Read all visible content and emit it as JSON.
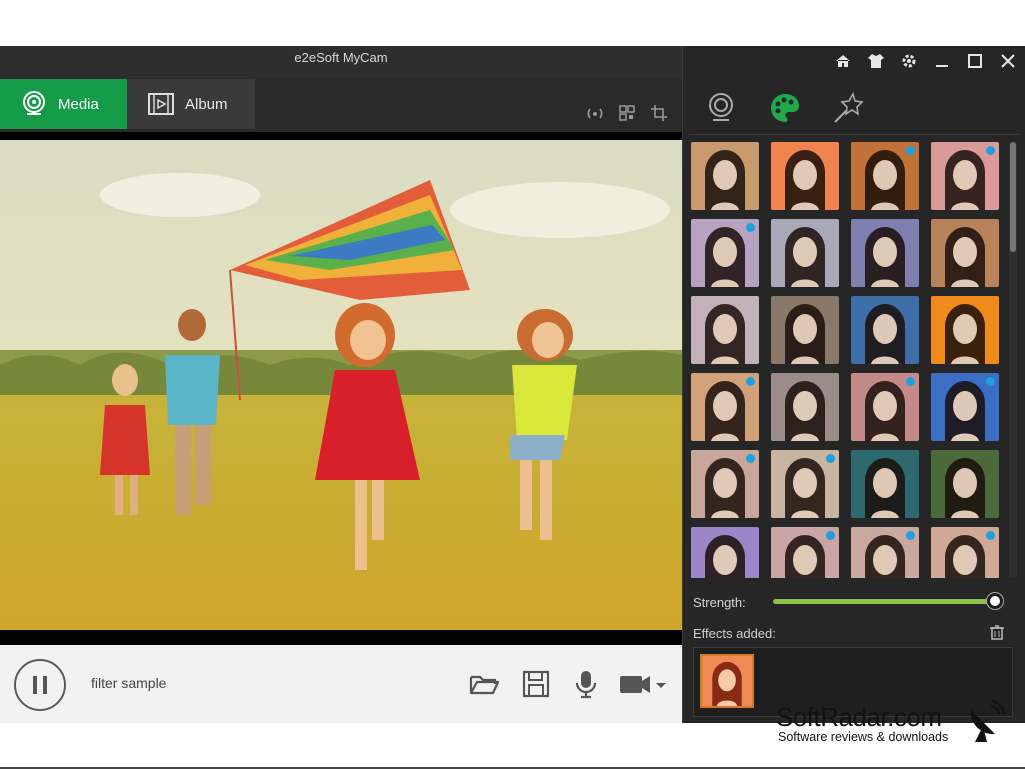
{
  "window": {
    "title": "e2eSoft MyCam"
  },
  "tabs": {
    "media_label": "Media",
    "album_label": "Album"
  },
  "bottom": {
    "filter_label": "filter sample"
  },
  "panel": {
    "strength_label": "Strength:",
    "strength_value": 1.0,
    "effects_label": "Effects added:"
  },
  "thumbnails": [
    {
      "tint": "#c99a6c",
      "dot": false
    },
    {
      "tint": "#f0834e",
      "dot": false
    },
    {
      "tint": "#c27138",
      "dot": true
    },
    {
      "tint": "#d99a98",
      "dot": true
    },
    {
      "tint": "#b7a3c0",
      "dot": true
    },
    {
      "tint": "#a8a8b8",
      "dot": false
    },
    {
      "tint": "#7f7fb0",
      "dot": false
    },
    {
      "tint": "#b8835a",
      "dot": false
    },
    {
      "tint": "#c0b2b8",
      "dot": false
    },
    {
      "tint": "#8a7868",
      "dot": false
    },
    {
      "tint": "#3f6fa8",
      "dot": false
    },
    {
      "tint": "#f08a1a",
      "dot": false
    },
    {
      "tint": "#d1a27a",
      "dot": true
    },
    {
      "tint": "#9b8c8a",
      "dot": false
    },
    {
      "tint": "#c48a88",
      "dot": true
    },
    {
      "tint": "#3a6fc4",
      "dot": true
    },
    {
      "tint": "#c6a79a",
      "dot": true
    },
    {
      "tint": "#c9b4a0",
      "dot": true
    },
    {
      "tint": "#2c6a70",
      "dot": false
    },
    {
      "tint": "#4a6a3a",
      "dot": false
    },
    {
      "tint": "#9a86c8",
      "dot": false
    },
    {
      "tint": "#c9a5a5",
      "dot": true
    },
    {
      "tint": "#c9a8a0",
      "dot": true
    },
    {
      "tint": "#cfa896",
      "dot": true
    }
  ],
  "colors": {
    "accent_green": "#159c49",
    "slider_green": "#8fc04a",
    "badge_blue": "#1e9fe0"
  },
  "watermark": {
    "name": "SoftRadar.com",
    "tagline": "Software reviews & downloads"
  }
}
